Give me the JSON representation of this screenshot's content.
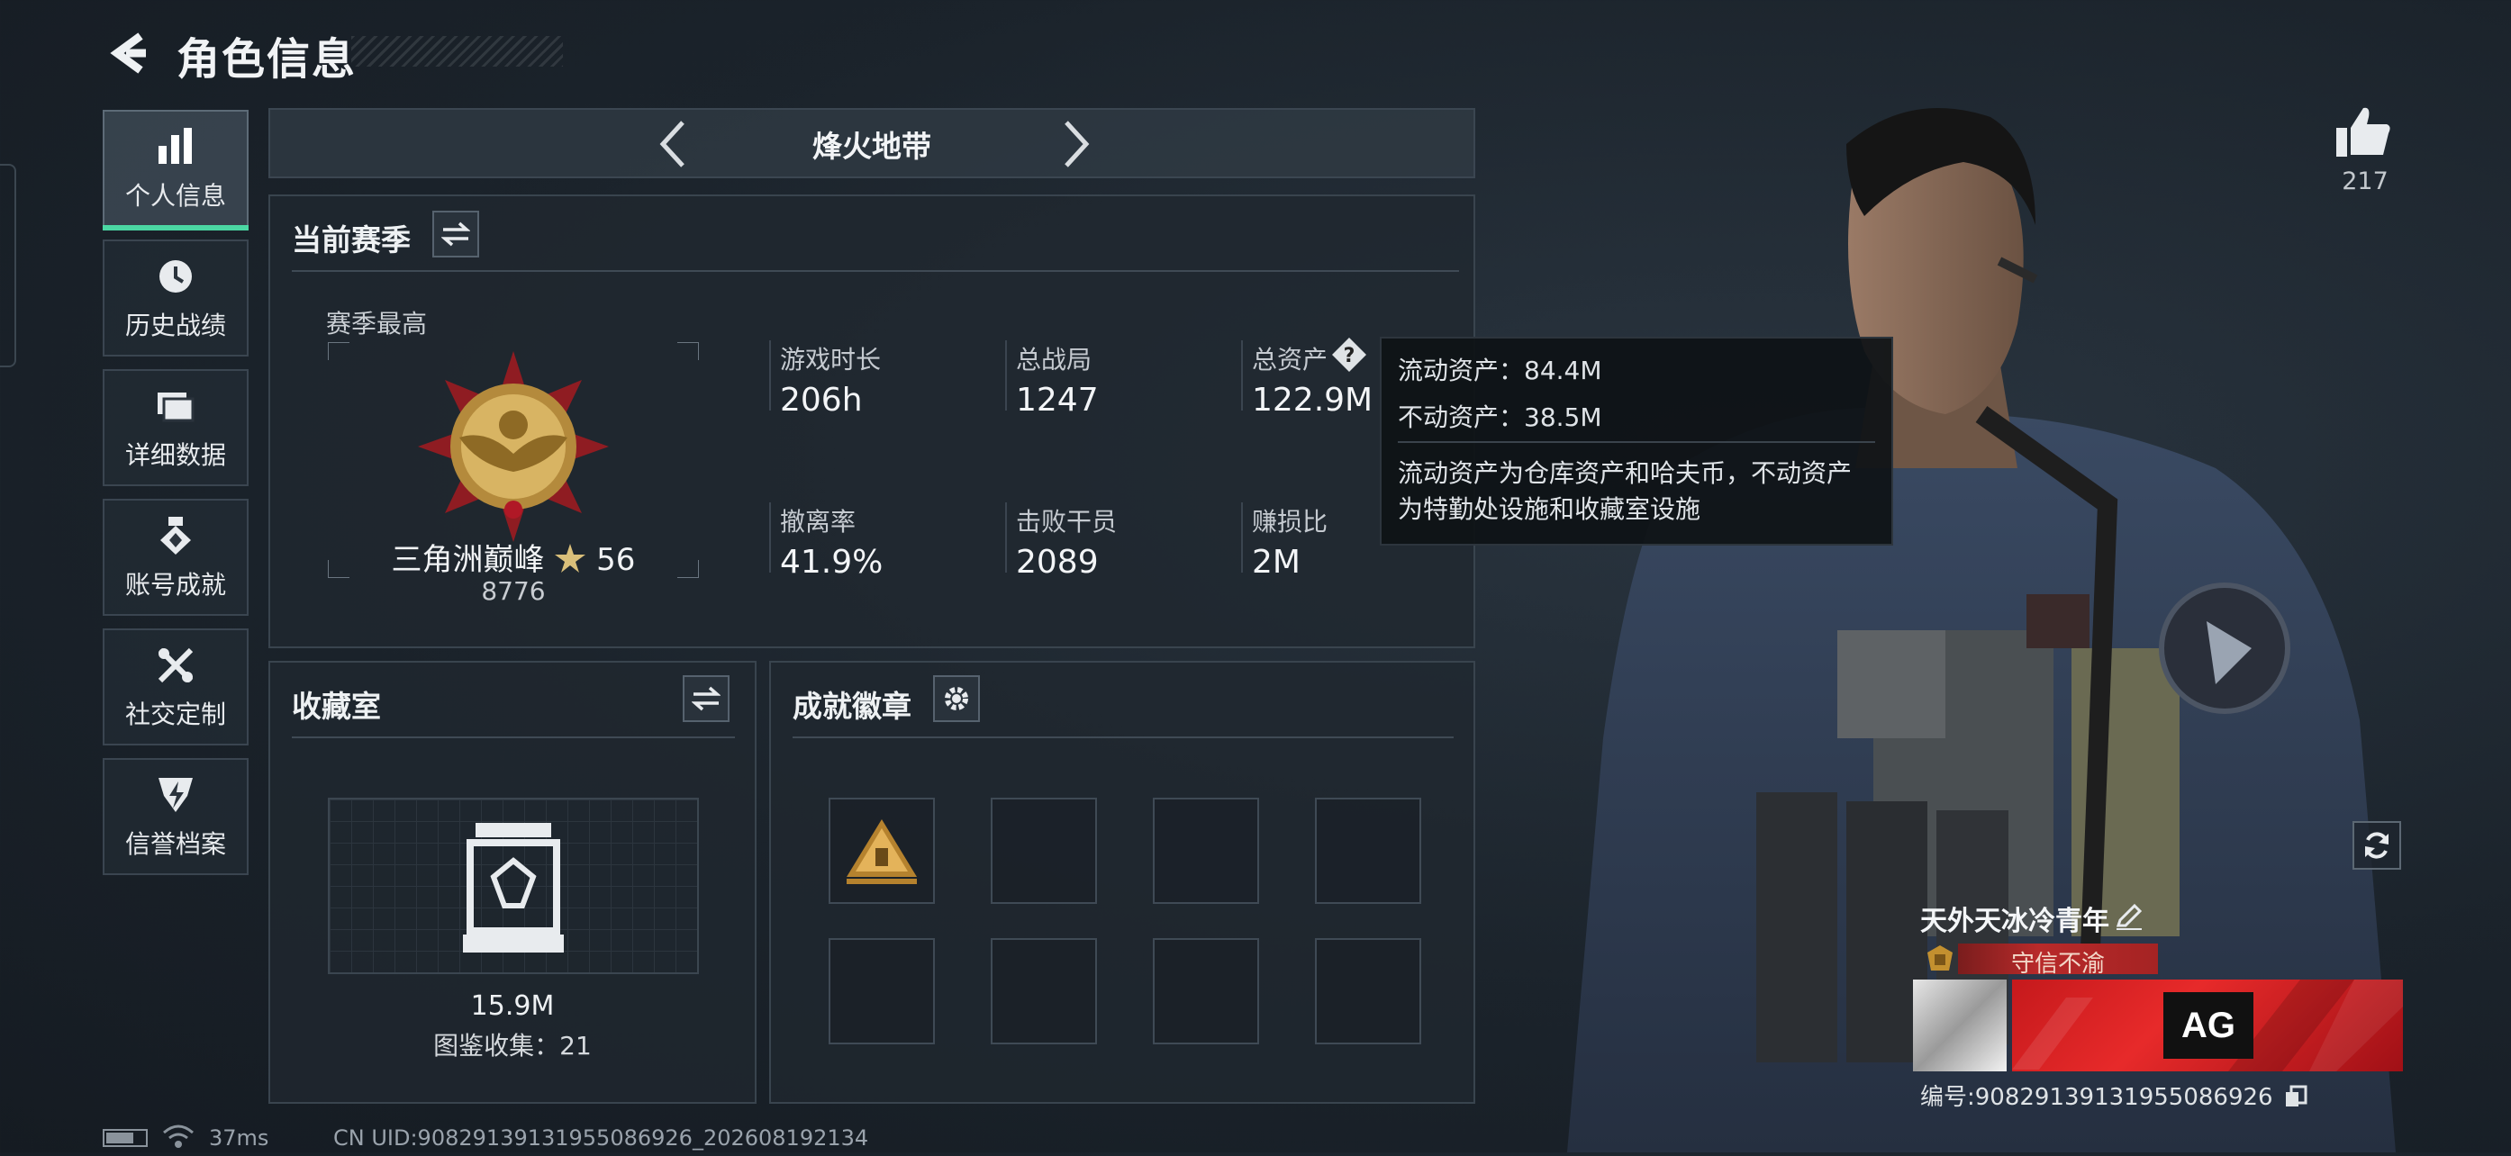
{
  "header": {
    "title": "角色信息"
  },
  "sidebar": {
    "items": [
      {
        "label": "个人信息",
        "icon": "bar-chart-icon",
        "active": true
      },
      {
        "label": "历史战绩",
        "icon": "clock-icon",
        "active": false
      },
      {
        "label": "详细数据",
        "icon": "folder-icon",
        "active": false
      },
      {
        "label": "账号成就",
        "icon": "medal-icon",
        "active": false
      },
      {
        "label": "社交定制",
        "icon": "tools-icon",
        "active": false
      },
      {
        "label": "信誉档案",
        "icon": "shield-icon",
        "active": false
      }
    ]
  },
  "mode": {
    "title": "烽火地带"
  },
  "season": {
    "title": "当前赛季",
    "best_label": "赛季最高",
    "rank_name": "三角洲巅峰",
    "rank_stars": "56",
    "rank_score": "8776",
    "stats": [
      {
        "label": "游戏时长",
        "value": "206h"
      },
      {
        "label": "总战局",
        "value": "1247"
      },
      {
        "label": "总资产",
        "value": "122.9M"
      },
      {
        "label": "撤离率",
        "value": "41.9%"
      },
      {
        "label": "击败干员",
        "value": "2089"
      },
      {
        "label": "赚损比",
        "value": "2M"
      }
    ]
  },
  "tooltip": {
    "liquid": "流动资产：84.4M",
    "fixed": "不动资产：38.5M",
    "desc_line1": "流动资产为仓库资产和哈夫币，不动资产",
    "desc_line2": "为特勤处设施和收藏室设施"
  },
  "collection": {
    "title": "收藏室",
    "value": "15.9M",
    "catalog": "图鉴收集：21"
  },
  "achievements": {
    "title": "成就徽章"
  },
  "status": {
    "ping": "37ms",
    "uid": "CN UID:9082913913195508692​6_202608192134"
  },
  "player": {
    "likes": "217",
    "name": "天外天冰冷青年",
    "title": "守信不渝",
    "team_logo": "AG",
    "id_label": "编号:9082913913195508692​6"
  },
  "colors": {
    "accent": "#4bd7a3",
    "title_red": "#b82a2a",
    "banner_red": "#e72a2a"
  }
}
